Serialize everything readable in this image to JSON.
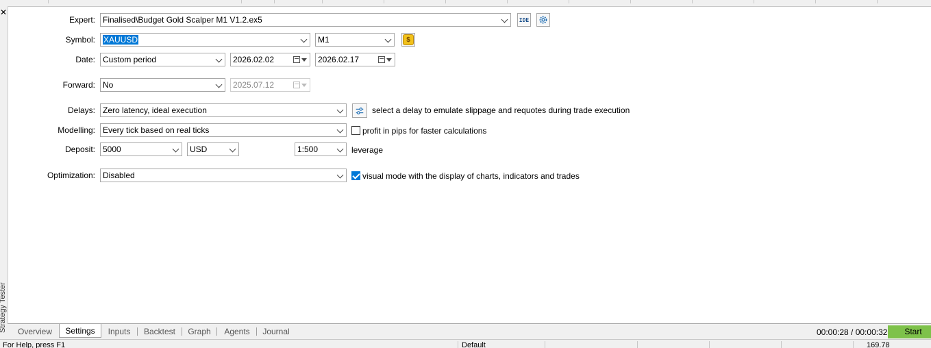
{
  "panel": {
    "side_title": "Strategy Tester"
  },
  "expert": {
    "label": "Expert:",
    "value": "Finalised\\Budget Gold Scalper M1 V1.2.ex5",
    "ide_label": "IDE"
  },
  "symbol": {
    "label": "Symbol:",
    "value": "XAUUSD",
    "timeframe": "M1",
    "currency_icon": "$"
  },
  "date": {
    "label": "Date:",
    "mode": "Custom period",
    "from": "2026.02.02",
    "to": "2026.02.17"
  },
  "forward": {
    "label": "Forward:",
    "mode": "No",
    "date": "2025.07.12"
  },
  "delays": {
    "label": "Delays:",
    "value": "Zero latency, ideal execution",
    "hint": "select a delay to emulate slippage and requotes during trade execution"
  },
  "modelling": {
    "label": "Modelling:",
    "value": "Every tick based on real ticks",
    "pips_label": "profit in pips for faster calculations",
    "pips_checked": false
  },
  "deposit": {
    "label": "Deposit:",
    "amount": "5000",
    "currency": "USD",
    "leverage_value": "1:500",
    "leverage_label": "leverage"
  },
  "optimization": {
    "label": "Optimization:",
    "value": "Disabled",
    "visual_label": "visual mode with the display of charts, indicators and trades",
    "visual_checked": true
  },
  "tabs": [
    "Overview",
    "Settings",
    "Inputs",
    "Backtest",
    "Graph",
    "Agents",
    "Journal"
  ],
  "active_tab": "Settings",
  "timer": "00:00:28 / 00:00:32",
  "start_label": "Start",
  "statusbar": {
    "left": "For Help, press F1",
    "profile": "Default",
    "right": "169.78"
  },
  "colors": {
    "start_button": "#7ec24a",
    "selection": "#0078d7",
    "checkbox": "#0078d7"
  }
}
